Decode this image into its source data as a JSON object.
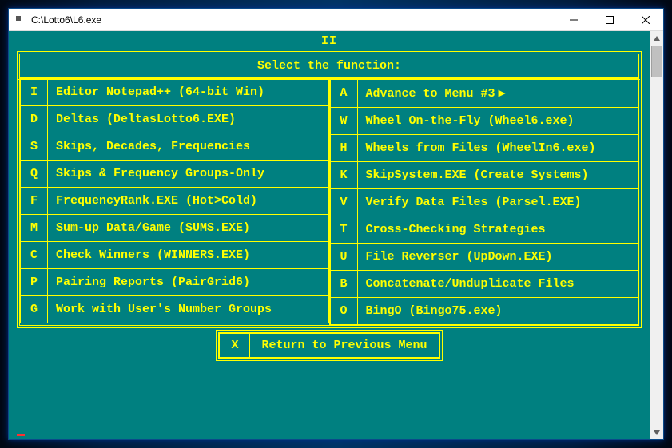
{
  "window": {
    "title": "C:\\Lotto6\\L6.exe"
  },
  "screen": {
    "label": "II",
    "heading": "Select the function:"
  },
  "left_menu": [
    {
      "key": "I",
      "label": "Editor Notepad++ (64-bit Win)"
    },
    {
      "key": "D",
      "label": "Deltas (DeltasLotto6.EXE)"
    },
    {
      "key": "S",
      "label": "Skips, Decades, Frequencies"
    },
    {
      "key": "Q",
      "label": "Skips & Frequency Groups-Only"
    },
    {
      "key": "F",
      "label": "FrequencyRank.EXE (Hot>Cold)"
    },
    {
      "key": "M",
      "label": "Sum-up Data/Game (SUMS.EXE)"
    },
    {
      "key": "C",
      "label": "Check Winners (WINNERS.EXE)"
    },
    {
      "key": "P",
      "label": "Pairing Reports (PairGrid6)"
    },
    {
      "key": "G",
      "label": "Work with User's Number Groups"
    }
  ],
  "right_menu": [
    {
      "key": "A",
      "label": "Advance to Menu #3",
      "arrow": true
    },
    {
      "key": "W",
      "label": "Wheel On-the-Fly (Wheel6.exe)"
    },
    {
      "key": "H",
      "label": "Wheels from Files (WheelIn6.exe)"
    },
    {
      "key": "K",
      "label": "SkipSystem.EXE (Create Systems)"
    },
    {
      "key": "V",
      "label": "Verify Data Files (Parsel.EXE)"
    },
    {
      "key": "T",
      "label": "Cross-Checking Strategies"
    },
    {
      "key": "U",
      "label": "File Reverser (UpDown.EXE)"
    },
    {
      "key": "B",
      "label": "Concatenate/Unduplicate Files"
    },
    {
      "key": "O",
      "label": "BingO (Bingo75.exe)"
    }
  ],
  "footer": {
    "key": "X",
    "label": "Return to Previous Menu"
  }
}
